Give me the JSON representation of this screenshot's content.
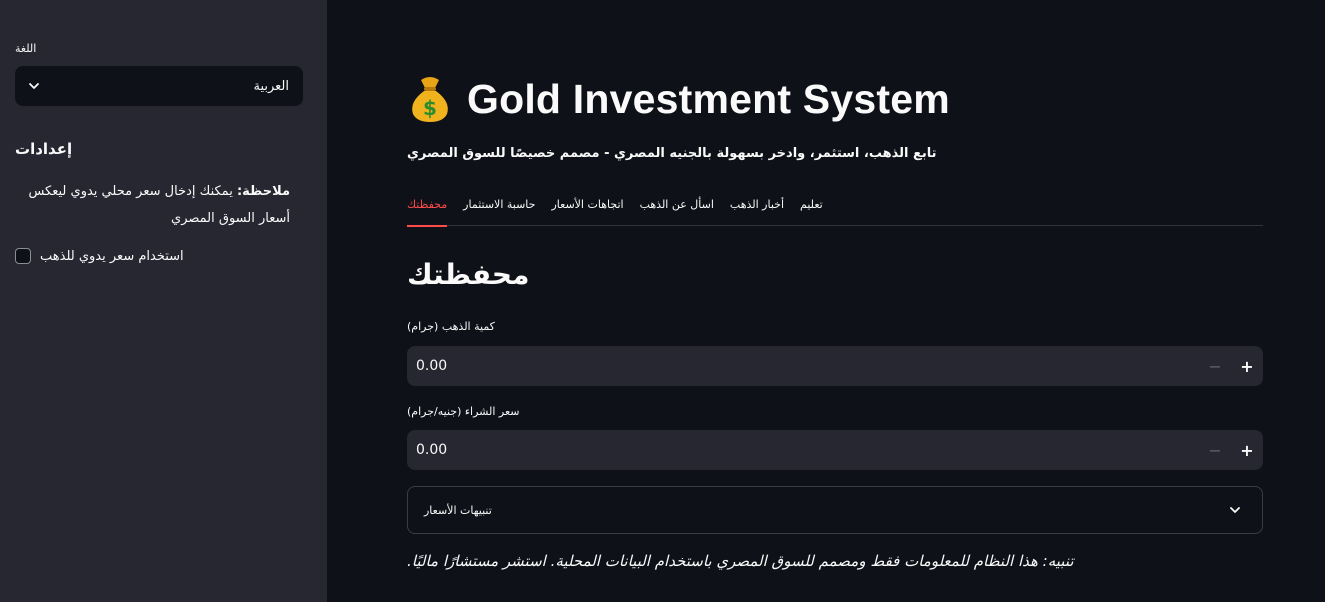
{
  "sidebar": {
    "language_label": "اللغة",
    "language_value": "العربية",
    "settings_title": "إعدادات",
    "note_bold": "ملاحظة:",
    "note_text": " يمكنك إدخال سعر محلي يدوي ليعكس أسعار السوق المصري",
    "manual_price_label": "استخدام سعر يدوي للذهب",
    "manual_price_checked": false
  },
  "header": {
    "icon": "money-bag-icon",
    "title": "Gold Investment System",
    "subtitle": "تابع الذهب، استثمر، وادخر بسهولة بالجنيه المصري - مصمم خصيصًا للسوق المصري"
  },
  "tabs": [
    {
      "label": "محفظتك",
      "active": true
    },
    {
      "label": "حاسبة الاستثمار",
      "active": false
    },
    {
      "label": "اتجاهات الأسعار",
      "active": false
    },
    {
      "label": "اسأل عن الذهب",
      "active": false
    },
    {
      "label": "أخبار الذهب",
      "active": false
    },
    {
      "label": "تعليم",
      "active": false
    }
  ],
  "portfolio": {
    "title": "محفظتك",
    "gold_amount_label": "كمية الذهب (جرام)",
    "gold_amount_value": "0.00",
    "buy_price_label": "سعر الشراء (جنيه/جرام)",
    "buy_price_value": "0.00",
    "alerts_label": "تنبيهات الأسعار"
  },
  "disclaimer": ".تنبيه: هذا النظام للمعلومات فقط ومصمم للسوق المصري باستخدام البيانات المحلية. استشر مستشارًا ماليًا",
  "colors": {
    "background": "#0e1117",
    "sidebar": "#262730",
    "accent": "#ff4b4b",
    "text": "#fafafa"
  }
}
